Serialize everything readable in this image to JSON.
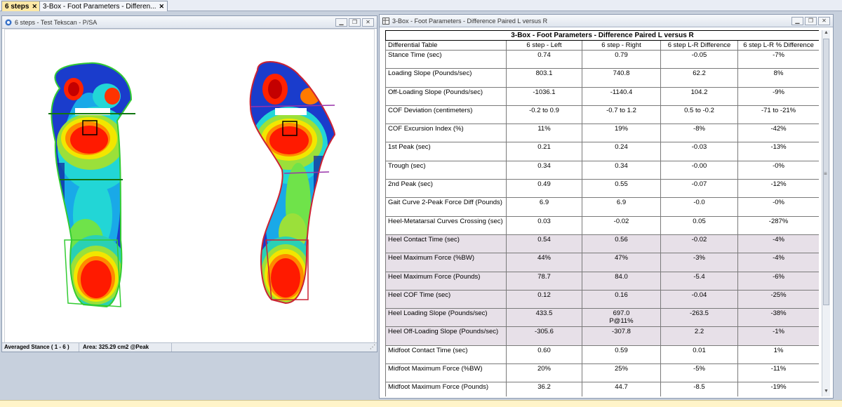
{
  "tabs": [
    {
      "label": "6 steps",
      "active": true
    },
    {
      "label": "3-Box - Foot Parameters - Differen...",
      "active": false
    }
  ],
  "left_window": {
    "title": "6 steps - Test  Tekscan - P/SA",
    "status": {
      "stance": "Averaged Stance ( 1 - 6 )",
      "area": "Area: 325.29 cm2 @Peak"
    }
  },
  "right_window": {
    "title": "3-Box - Foot Parameters - Difference Paired L versus R",
    "table": {
      "caption": "3-Box - Foot Parameters - Difference Paired L versus R",
      "headers": [
        "Differential Table",
        "6 step - Left",
        "6 step - Right",
        "6 step L-R Difference",
        "6 step L-R % Difference"
      ],
      "rows": [
        {
          "param": "Stance Time (sec)",
          "left": "0.74",
          "right": "0.79",
          "diff": "-0.05",
          "pct": "-7%",
          "shaded": false
        },
        {
          "param": "Loading Slope (Pounds/sec)",
          "left": "803.1",
          "right": "740.8",
          "diff": "62.2",
          "pct": "8%",
          "shaded": false
        },
        {
          "param": "Off-Loading Slope (Pounds/sec)",
          "left": "-1036.1",
          "right": "-1140.4",
          "diff": "104.2",
          "pct": "-9%",
          "shaded": false
        },
        {
          "param": "COF Deviation (centimeters)",
          "left": "-0.2 to 0.9",
          "right": "-0.7 to 1.2",
          "diff": "0.5 to -0.2",
          "pct": "-71 to -21%",
          "shaded": false
        },
        {
          "param": "COF Excursion Index (%)",
          "left": "11%",
          "right": "19%",
          "diff": "-8%",
          "pct": "-42%",
          "shaded": false
        },
        {
          "param": "1st Peak (sec)",
          "left": "0.21",
          "right": "0.24",
          "diff": "-0.03",
          "pct": "-13%",
          "shaded": false
        },
        {
          "param": "Trough (sec)",
          "left": "0.34",
          "right": "0.34",
          "diff": "-0.00",
          "pct": "-0%",
          "shaded": false
        },
        {
          "param": "2nd Peak (sec)",
          "left": "0.49",
          "right": "0.55",
          "diff": "-0.07",
          "pct": "-12%",
          "shaded": false
        },
        {
          "param": "Gait Curve 2-Peak Force Diff (Pounds)",
          "left": "6.9",
          "right": "6.9",
          "diff": "-0.0",
          "pct": "-0%",
          "shaded": false
        },
        {
          "param": "Heel-Metatarsal Curves Crossing (sec)",
          "left": "0.03",
          "right": "-0.02",
          "diff": "0.05",
          "pct": "-287%",
          "shaded": false
        },
        {
          "param": "Heel Contact Time (sec)",
          "left": "0.54",
          "right": "0.56",
          "diff": "-0.02",
          "pct": "-4%",
          "shaded": true
        },
        {
          "param": "Heel Maximum Force (%BW)",
          "left": "44%",
          "right": "47%",
          "diff": "-3%",
          "pct": "-4%",
          "shaded": true
        },
        {
          "param": "Heel Maximum Force (Pounds)",
          "left": "78.7",
          "right": "84.0",
          "diff": "-5.4",
          "pct": "-6%",
          "shaded": true
        },
        {
          "param": "Heel COF Time (sec)",
          "left": "0.12",
          "right": "0.16",
          "diff": "-0.04",
          "pct": "-25%",
          "shaded": true
        },
        {
          "param": "Heel Loading Slope (Pounds/sec)",
          "left": "433.5",
          "right": "697.0",
          "right_note": "P@11%",
          "diff": "-263.5",
          "pct": "-38%",
          "shaded": true
        },
        {
          "param": "Heel Off-Loading Slope (Pounds/sec)",
          "left": "-305.6",
          "right": "-307.8",
          "diff": "2.2",
          "pct": "-1%",
          "shaded": true
        },
        {
          "param": "Midfoot Contact Time (sec)",
          "left": "0.60",
          "right": "0.59",
          "diff": "0.01",
          "pct": "1%",
          "shaded": false
        },
        {
          "param": "Midfoot Maximum Force (%BW)",
          "left": "20%",
          "right": "25%",
          "diff": "-5%",
          "pct": "-11%",
          "shaded": false
        },
        {
          "param": "Midfoot Maximum Force (Pounds)",
          "left": "36.2",
          "right": "44.7",
          "diff": "-8.5",
          "pct": "-19%",
          "shaded": false
        }
      ]
    }
  },
  "colors": {
    "left_foot_outline": "#33cc33",
    "right_foot_outline": "#cc2233",
    "box_line_left": "#117711",
    "box_line_right": "#9933aa",
    "shaded_row": "#e7e0e8"
  },
  "icons": {
    "close": "close-icon",
    "minimize": "minimize-icon",
    "restore": "restore-icon"
  }
}
